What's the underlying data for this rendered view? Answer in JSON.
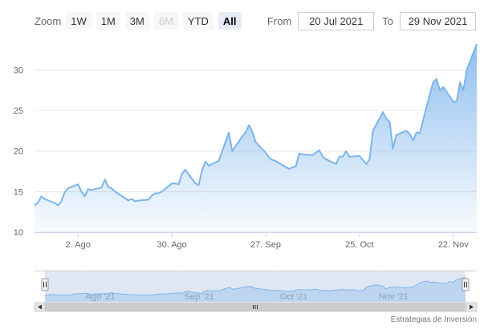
{
  "zoom": {
    "label": "Zoom",
    "buttons": [
      {
        "label": "1W",
        "state": "normal"
      },
      {
        "label": "1M",
        "state": "normal"
      },
      {
        "label": "3M",
        "state": "normal"
      },
      {
        "label": "6M",
        "state": "disabled"
      },
      {
        "label": "YTD",
        "state": "normal"
      },
      {
        "label": "All",
        "state": "active"
      }
    ]
  },
  "range": {
    "from_label": "From",
    "from_value": "20 Jul 2021",
    "to_label": "To",
    "to_value": "29 Nov 2021"
  },
  "credits": "Estrategias de Inversión",
  "colors": {
    "line": "#7cb5ec",
    "area_top": "#7cb5ec",
    "grid": "#e6e6e6",
    "navigator_mask": "#dde4f2",
    "scrollbar": "#cccccc"
  },
  "chart_data": {
    "type": "area",
    "title": "",
    "xlabel": "",
    "ylabel": "",
    "ylim": [
      10,
      33.5
    ],
    "yticks": [
      10,
      15,
      20,
      25,
      30
    ],
    "xtick_labels": [
      {
        "date": "2021-08-02",
        "label": "2. Ago"
      },
      {
        "date": "2021-08-30",
        "label": "30. Ago"
      },
      {
        "date": "2021-09-27",
        "label": "27. Sep"
      },
      {
        "date": "2021-10-25",
        "label": "25. Oct"
      },
      {
        "date": "2021-11-22",
        "label": "22. Nov"
      }
    ],
    "xrange": [
      "2021-07-20",
      "2021-11-29"
    ],
    "grid": true,
    "series": [
      {
        "values": [
          {
            "x": "2021-07-20",
            "y": 13.3
          },
          {
            "x": "2021-07-21",
            "y": 13.6
          },
          {
            "x": "2021-07-22",
            "y": 14.4
          },
          {
            "x": "2021-07-23",
            "y": 14.1
          },
          {
            "x": "2021-07-26",
            "y": 13.6
          },
          {
            "x": "2021-07-27",
            "y": 13.3
          },
          {
            "x": "2021-07-28",
            "y": 13.8
          },
          {
            "x": "2021-07-29",
            "y": 14.9
          },
          {
            "x": "2021-07-30",
            "y": 15.4
          },
          {
            "x": "2021-08-02",
            "y": 15.9
          },
          {
            "x": "2021-08-03",
            "y": 15.0
          },
          {
            "x": "2021-08-04",
            "y": 14.4
          },
          {
            "x": "2021-08-05",
            "y": 15.3
          },
          {
            "x": "2021-08-06",
            "y": 15.2
          },
          {
            "x": "2021-08-09",
            "y": 15.5
          },
          {
            "x": "2021-08-10",
            "y": 16.5
          },
          {
            "x": "2021-08-11",
            "y": 15.6
          },
          {
            "x": "2021-08-12",
            "y": 15.4
          },
          {
            "x": "2021-08-13",
            "y": 15.0
          },
          {
            "x": "2021-08-16",
            "y": 14.2
          },
          {
            "x": "2021-08-17",
            "y": 13.9
          },
          {
            "x": "2021-08-18",
            "y": 14.1
          },
          {
            "x": "2021-08-19",
            "y": 13.8
          },
          {
            "x": "2021-08-20",
            "y": 13.9
          },
          {
            "x": "2021-08-23",
            "y": 14.0
          },
          {
            "x": "2021-08-24",
            "y": 14.5
          },
          {
            "x": "2021-08-25",
            "y": 14.8
          },
          {
            "x": "2021-08-26",
            "y": 14.8
          },
          {
            "x": "2021-08-27",
            "y": 15.0
          },
          {
            "x": "2021-08-30",
            "y": 16.0
          },
          {
            "x": "2021-08-31",
            "y": 16.0
          },
          {
            "x": "2021-09-01",
            "y": 15.9
          },
          {
            "x": "2021-09-02",
            "y": 17.2
          },
          {
            "x": "2021-09-03",
            "y": 17.7
          },
          {
            "x": "2021-09-06",
            "y": 16.0
          },
          {
            "x": "2021-09-07",
            "y": 15.8
          },
          {
            "x": "2021-09-08",
            "y": 17.6
          },
          {
            "x": "2021-09-09",
            "y": 18.7
          },
          {
            "x": "2021-09-10",
            "y": 18.2
          },
          {
            "x": "2021-09-13",
            "y": 18.8
          },
          {
            "x": "2021-09-14",
            "y": 20.0
          },
          {
            "x": "2021-09-15",
            "y": 21.1
          },
          {
            "x": "2021-09-16",
            "y": 22.3
          },
          {
            "x": "2021-09-17",
            "y": 20.0
          },
          {
            "x": "2021-09-20",
            "y": 21.8
          },
          {
            "x": "2021-09-21",
            "y": 22.3
          },
          {
            "x": "2021-09-22",
            "y": 23.2
          },
          {
            "x": "2021-09-23",
            "y": 22.4
          },
          {
            "x": "2021-09-24",
            "y": 21.1
          },
          {
            "x": "2021-09-27",
            "y": 19.8
          },
          {
            "x": "2021-09-28",
            "y": 19.2
          },
          {
            "x": "2021-09-29",
            "y": 18.9
          },
          {
            "x": "2021-09-30",
            "y": 18.8
          },
          {
            "x": "2021-10-01",
            "y": 18.5
          },
          {
            "x": "2021-10-04",
            "y": 17.8
          },
          {
            "x": "2021-10-05",
            "y": 18.0
          },
          {
            "x": "2021-10-06",
            "y": 18.1
          },
          {
            "x": "2021-10-07",
            "y": 19.7
          },
          {
            "x": "2021-10-08",
            "y": 19.6
          },
          {
            "x": "2021-10-11",
            "y": 19.5
          },
          {
            "x": "2021-10-12",
            "y": 19.8
          },
          {
            "x": "2021-10-13",
            "y": 20.1
          },
          {
            "x": "2021-10-14",
            "y": 19.3
          },
          {
            "x": "2021-10-15",
            "y": 19.0
          },
          {
            "x": "2021-10-18",
            "y": 18.4
          },
          {
            "x": "2021-10-19",
            "y": 19.3
          },
          {
            "x": "2021-10-20",
            "y": 19.3
          },
          {
            "x": "2021-10-21",
            "y": 20.0
          },
          {
            "x": "2021-10-22",
            "y": 19.3
          },
          {
            "x": "2021-10-25",
            "y": 19.4
          },
          {
            "x": "2021-10-26",
            "y": 18.9
          },
          {
            "x": "2021-10-27",
            "y": 18.4
          },
          {
            "x": "2021-10-28",
            "y": 19.0
          },
          {
            "x": "2021-10-29",
            "y": 22.5
          },
          {
            "x": "2021-11-01",
            "y": 24.8
          },
          {
            "x": "2021-11-02",
            "y": 24.0
          },
          {
            "x": "2021-11-03",
            "y": 23.6
          },
          {
            "x": "2021-11-04",
            "y": 20.3
          },
          {
            "x": "2021-11-05",
            "y": 22.0
          },
          {
            "x": "2021-11-08",
            "y": 22.5
          },
          {
            "x": "2021-11-09",
            "y": 22.1
          },
          {
            "x": "2021-11-10",
            "y": 21.3
          },
          {
            "x": "2021-11-11",
            "y": 22.3
          },
          {
            "x": "2021-11-12",
            "y": 22.2
          },
          {
            "x": "2021-11-15",
            "y": 27.0
          },
          {
            "x": "2021-11-16",
            "y": 28.5
          },
          {
            "x": "2021-11-17",
            "y": 28.9
          },
          {
            "x": "2021-11-18",
            "y": 27.5
          },
          {
            "x": "2021-11-19",
            "y": 27.9
          },
          {
            "x": "2021-11-22",
            "y": 26.1
          },
          {
            "x": "2021-11-23",
            "y": 26.1
          },
          {
            "x": "2021-11-24",
            "y": 28.5
          },
          {
            "x": "2021-11-25",
            "y": 27.5
          },
          {
            "x": "2021-11-26",
            "y": 30.0
          },
          {
            "x": "2021-11-29",
            "y": 33.2
          }
        ]
      }
    ],
    "navigator": {
      "xtick_labels": [
        {
          "date": "2021-08-01",
          "label": "Ago '21"
        },
        {
          "date": "2021-09-01",
          "label": "Sep '21"
        },
        {
          "date": "2021-10-01",
          "label": "Oct '21"
        },
        {
          "date": "2021-11-01",
          "label": "Nov '21"
        }
      ]
    }
  }
}
